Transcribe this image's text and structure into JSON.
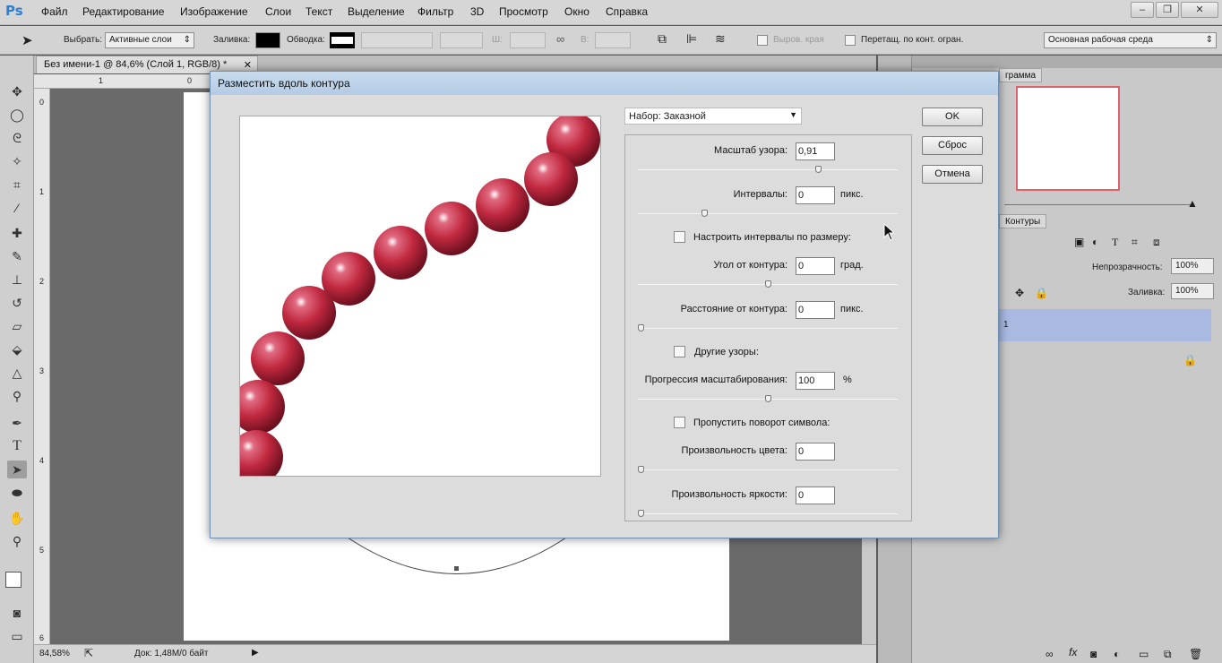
{
  "app": {
    "logo": "Ps"
  },
  "menu": [
    "Файл",
    "Редактирование",
    "Изображение",
    "Слои",
    "Текст",
    "Выделение",
    "Фильтр",
    "3D",
    "Просмотр",
    "Окно",
    "Справка"
  ],
  "window_buttons": {
    "minimize": "–",
    "restore": "❐",
    "close": "✕"
  },
  "options": {
    "select_label": "Выбрать:",
    "select_value": "Активные слои",
    "fill_label": "Заливка:",
    "stroke_label": "Обводка:",
    "w_label": "Ш:",
    "h_label": "В:",
    "align_edges": "Выров. края",
    "constrain": "Перетащ. по конт. огран.",
    "workspace": "Основная рабочая среда"
  },
  "document": {
    "tab_title": "Без имени-1 @ 84,6% (Слой 1, RGB/8) *",
    "ruler_top": [
      "1",
      "0"
    ],
    "ruler_left": [
      "0",
      "1",
      "2",
      "3",
      "4",
      "5",
      "6"
    ],
    "zoom": "84,58%",
    "doc_info": "Док: 1,48M/0 байт"
  },
  "panels": {
    "histogram_tab": "грамма",
    "paths_tab": "Контуры",
    "opacity_label": "Непрозрачность:",
    "opacity_value": "100%",
    "fill_label": "Заливка:",
    "fill_value": "100%",
    "layer_name_fragment": "1"
  },
  "dialog": {
    "title": "Разместить вдоль контура",
    "preset": "Набор: Заказной",
    "ok": "OK",
    "reset": "Сброс",
    "cancel": "Отмена",
    "scale_label": "Масштаб узора:",
    "scale_value": "0,91",
    "spacing_label": "Интервалы:",
    "spacing_value": "0",
    "spacing_unit": "пикс.",
    "adjust_spacing": "Настроить интервалы по размеру:",
    "angle_label": "Угол от контура:",
    "angle_value": "0",
    "angle_unit": "град.",
    "distance_label": "Расстояние от контура:",
    "distance_value": "0",
    "distance_unit": "пикс.",
    "alt_patterns": "Другие узоры:",
    "scale_progression_label": "Прогрессия масштабирования:",
    "scale_progression_value": "100",
    "scale_progression_unit": "%",
    "skip_rotation": "Пропустить поворот символа:",
    "color_random_label": "Произвольность цвета:",
    "color_random_value": "0",
    "brightness_random_label": "Произвольность яркости:",
    "brightness_random_value": "0",
    "slider_levels": {
      "scale": 0.7,
      "spacing": 0.25,
      "angle": 0.5,
      "distance": 0,
      "progression": 0.5,
      "color": 0,
      "brightness": 0
    }
  },
  "colors": {
    "bead": "#c0283f",
    "accent": "#2d7fd3"
  }
}
